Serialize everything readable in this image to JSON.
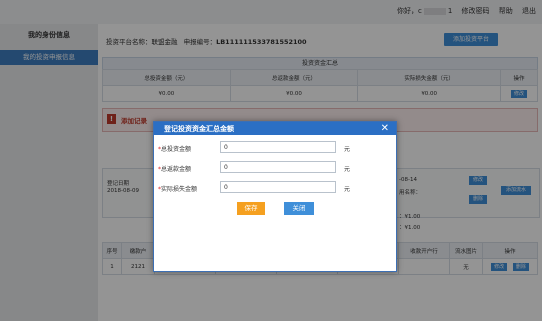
{
  "topbar": {
    "greeting": "你好，c",
    "user_suffix": "1",
    "change_password": "修改密码",
    "help": "帮助",
    "logout": "退出"
  },
  "sidebar": {
    "heading": "我的身份信息",
    "active_item": "我的投资申报信息"
  },
  "info": {
    "platform_label": "投资平台名称：",
    "platform_name": "联盟金融",
    "report_label": "申报编号：",
    "report_no": "LB111111533781552100"
  },
  "add_platform_button": "添加投资平台",
  "summary": {
    "title": "投资资金汇总",
    "columns": [
      "总投资金额（元）",
      "总返款金额（元）",
      "实际损失金额（元）",
      "操作"
    ],
    "values": [
      "¥0.00",
      "¥0.00",
      "¥0.00"
    ],
    "edit": "修改"
  },
  "warning": {
    "text": "添加记录"
  },
  "record": {
    "date_label": "登记日期",
    "date_value": "2018-08-09",
    "right_date": "-08-14",
    "right_name": "用名称：",
    "amount1": "：¥1.00",
    "amount2": "：¥1.00",
    "edit": "修改",
    "delete": "删除",
    "add_flow": "添加流水"
  },
  "list": {
    "columns": [
      "序号",
      "缴款户",
      "",
      "",
      "",
      "",
      "收款开户行",
      "流水图片",
      "操作"
    ],
    "row": [
      "1",
      "2121",
      "",
      "",
      "",
      "",
      "",
      "无"
    ],
    "edit": "修改",
    "delete": "删除"
  },
  "modal": {
    "title": "登记投资资金汇总金额",
    "fields": [
      {
        "label": "总投资金额",
        "value": "0",
        "unit": "元"
      },
      {
        "label": "总返款金额",
        "value": "0",
        "unit": "元"
      },
      {
        "label": "实际损失金额",
        "value": "0",
        "unit": "元"
      }
    ],
    "save": "保存",
    "close": "关闭"
  },
  "colors": {
    "primary": "#3f8fd9",
    "header": "#2b6fc4",
    "save": "#f5a020",
    "warning": "#c0392b"
  }
}
